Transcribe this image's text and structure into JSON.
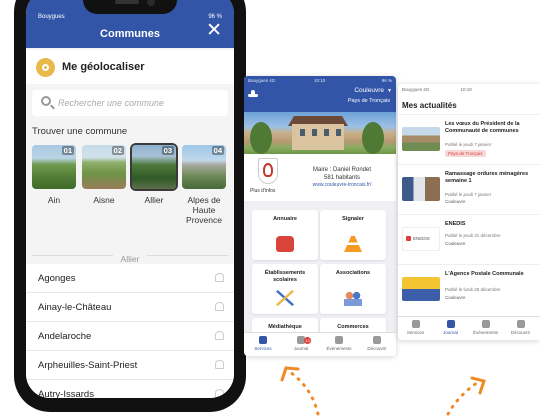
{
  "colors": {
    "accent": "#3355a8",
    "decor_orange": "#f08a24",
    "location_yellow": "#e8b84b"
  },
  "communes_screen": {
    "status": {
      "carrier": "Bouygues",
      "battery": "96 %"
    },
    "title": "Communes",
    "close_icon": "close-icon",
    "geolocate_label": "Me géolocaliser",
    "search_placeholder": "Rechercher une commune",
    "find_label": "Trouver une commune",
    "departments": [
      {
        "num": "01",
        "name": "Ain"
      },
      {
        "num": "02",
        "name": "Aisne"
      },
      {
        "num": "03",
        "name": "Allier"
      },
      {
        "num": "04",
        "name": "Alpes de Haute Provence"
      }
    ],
    "selected_department": "Allier",
    "communes": [
      "Agonges",
      "Ainay-le-Château",
      "Andelaroche",
      "Arpheuilles-Saint-Priest",
      "Autry-Issards"
    ]
  },
  "home_screen": {
    "status": {
      "carrier": "Bouygues 4G",
      "time": "10:10",
      "battery": "96 %"
    },
    "commune": "Couleuvre",
    "pays": "Pays de Tronçais",
    "plus_infos": "Plus d'infos",
    "maire": "Maire : Daniel Rondet",
    "habitants": "581 habitants",
    "website": "www.couleuvre-troncais.fr/",
    "services": [
      {
        "label": "Annuaire",
        "icon": "phone-icon"
      },
      {
        "label": "Signaler",
        "icon": "traffic-cone-icon"
      },
      {
        "label": "Établissements scolaires",
        "icon": "school-tools-icon"
      },
      {
        "label": "Associations",
        "icon": "people-icon"
      },
      {
        "label": "Médiathèque",
        "icon": "book-icon"
      },
      {
        "label": "Commerces",
        "icon": "shop-icon"
      }
    ],
    "tabs": [
      {
        "label": "Services",
        "icon": "services-icon"
      },
      {
        "label": "Journal",
        "icon": "journal-icon"
      },
      {
        "label": "Événements",
        "icon": "calendar-icon"
      },
      {
        "label": "Découvrir",
        "icon": "discover-icon"
      }
    ],
    "journal_badge": "12"
  },
  "news_screen": {
    "status": {
      "carrier": "Bouygues 4G",
      "time": "10:10"
    },
    "title": "Mes actualités",
    "items": [
      {
        "title": "Les vœux du Président de la Communauté de communes",
        "date": "Publié le jeudi 7 janvier",
        "tag": "Pays de Tronçais"
      },
      {
        "title": "Ramassage ordures ménagères semaine 1",
        "date": "Publié le jeudi 7 janvier",
        "source": "Couleuvre"
      },
      {
        "title": "ENEDIS",
        "date": "Publié le jeudi 31 décembre",
        "source": "Couleuvre",
        "thumb_text": "ENEDIS"
      },
      {
        "title": "L'Agence Postale Communale",
        "date": "Publié le lundi 28 décembre",
        "source": "Couleuvre"
      }
    ],
    "tabs": [
      {
        "label": "Services",
        "icon": "services-icon"
      },
      {
        "label": "Journal",
        "icon": "journal-icon"
      },
      {
        "label": "Événements",
        "icon": "calendar-icon"
      },
      {
        "label": "Découvrir",
        "icon": "discover-icon"
      }
    ]
  }
}
